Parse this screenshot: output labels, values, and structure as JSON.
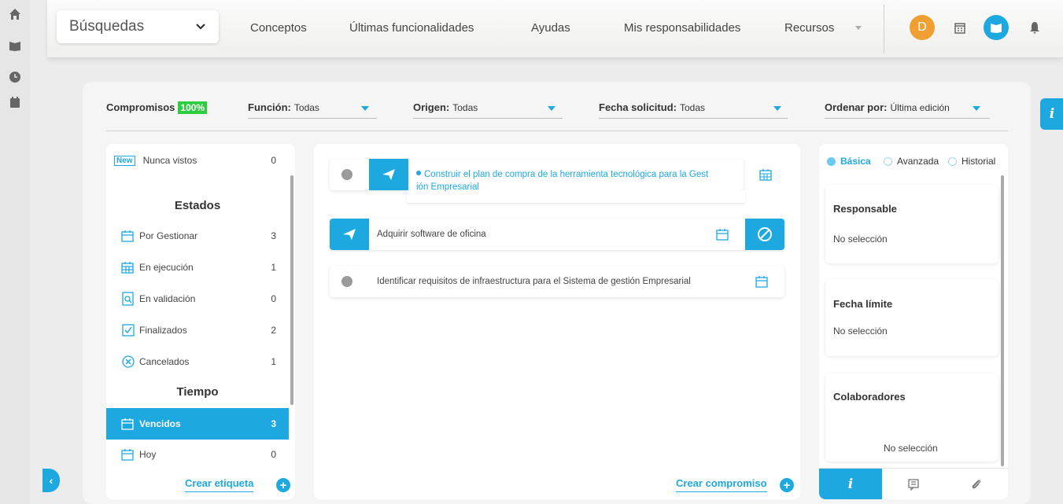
{
  "topbar": {
    "search_select": "Búsquedas",
    "nav": [
      "Conceptos",
      "Últimas funcionalidades",
      "Ayudas",
      "Mis responsabilidades",
      "Recursos"
    ],
    "avatar_initial": "D"
  },
  "filters": {
    "compromisos_label": "Compromisos",
    "compromisos_badge": "100%",
    "funcion_label": "Función:",
    "funcion_value": "Todas",
    "origen_label": "Origen:",
    "origen_value": "Todas",
    "fecha_label": "Fecha solicitud:",
    "fecha_value": "Todas",
    "ordenar_label": "Ordenar por:",
    "ordenar_value": "Última edición"
  },
  "left_panel": {
    "new_tag": "New",
    "nunca_label": "Nunca vistos",
    "nunca_count": "0",
    "estados_heading": "Estados",
    "estados": [
      {
        "label": "Por Gestionar",
        "count": "3",
        "icon": "calendar-icon"
      },
      {
        "label": "En ejecución",
        "count": "1",
        "icon": "calendar-grid-icon"
      },
      {
        "label": "En validación",
        "count": "0",
        "icon": "search-document-icon"
      },
      {
        "label": "Finalizados",
        "count": "2",
        "icon": "checkbox-icon"
      },
      {
        "label": "Cancelados",
        "count": "1",
        "icon": "x-circle-icon"
      }
    ],
    "tiempo_heading": "Tiempo",
    "tiempo": [
      {
        "label": "Vencidos",
        "count": "3",
        "icon": "calendar-flag-icon"
      },
      {
        "label": "Hoy",
        "count": "0",
        "icon": "calendar-flag-icon"
      }
    ],
    "footer": "Crear etiqueta"
  },
  "tasks": [
    {
      "text1": "Construir el plan de compra de la herramienta tecnológica para la Gest",
      "text2": "ión Empresarial"
    },
    {
      "text1": "Adquirir software de oficina"
    },
    {
      "text1": "Identificar requisitos de infraestructura para el Sistema de gestión Empresarial"
    }
  ],
  "center_footer": "Crear compromiso",
  "right_panel": {
    "radios": [
      "Básica",
      "Avanzada",
      "Historial"
    ],
    "sections": [
      {
        "heading": "Responsable",
        "value": "No selección"
      },
      {
        "heading": "Fecha límite",
        "value": "No selección"
      },
      {
        "heading": "Colaboradores",
        "value": "No selección"
      }
    ],
    "info_tab": "i"
  },
  "accent_color": "#1ea8e0"
}
